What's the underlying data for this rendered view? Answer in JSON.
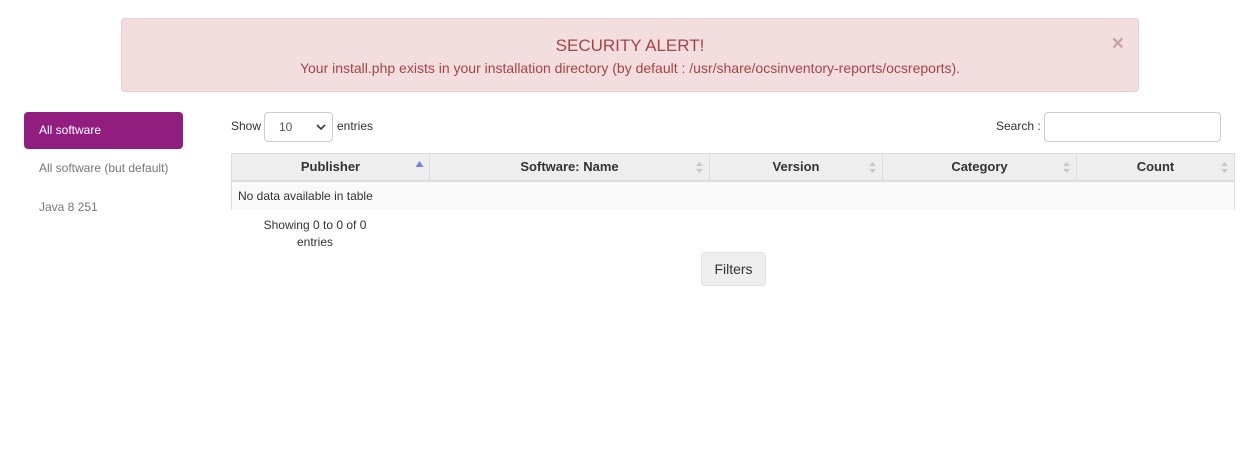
{
  "alert": {
    "title": "SECURITY ALERT!",
    "message": "Your install.php exists in your installation directory (by default : /usr/share/ocsinventory-reports/ocsreports).",
    "close_glyph": "×"
  },
  "sidebar": {
    "items": [
      {
        "label": "All software",
        "active": true
      },
      {
        "label": "All software (but default)",
        "active": false
      },
      {
        "label": "Java 8 251",
        "active": false
      }
    ]
  },
  "table_controls": {
    "show_label": "Show",
    "length_value": "10",
    "entries_label": "entries",
    "search_label": "Search :",
    "search_value": ""
  },
  "table": {
    "columns": [
      {
        "label": "Publisher",
        "sort": "ascending"
      },
      {
        "label": "Software: Name",
        "sort": "none"
      },
      {
        "label": "Version",
        "sort": "none"
      },
      {
        "label": "Category",
        "sort": "none"
      },
      {
        "label": "Count",
        "sort": "none"
      }
    ],
    "empty_message": "No data available in table",
    "info_line1": "Showing 0 to 0 of 0",
    "info_line2": "entries"
  },
  "filters_button": "Filters",
  "colors": {
    "accent": "#911e7f",
    "alert_bg": "#f2dede",
    "alert_text": "#a94442",
    "sort_active": "#6f86d6"
  }
}
